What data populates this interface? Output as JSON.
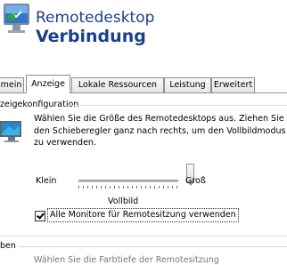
{
  "header": {
    "title_line1": "Remotedesktop",
    "title_line2": "Verbindung"
  },
  "tabs": [
    {
      "label": "mein",
      "active": false
    },
    {
      "label": "Anzeige",
      "active": true
    },
    {
      "label": "Lokale Ressourcen",
      "active": false
    },
    {
      "label": "Leistung",
      "active": false
    },
    {
      "label": "Erweitert",
      "active": false
    }
  ],
  "display_config": {
    "group_label": "zeigekonfiguration",
    "description": "Wählen Sie die Größe des Remotedesktops aus. Ziehen Sie den Schieberegler ganz nach rechts, um den Vollbildmodus zu verwenden.",
    "slider": {
      "min_label": "Klein",
      "max_label": "Groß",
      "value_label": "Vollbild",
      "position_fraction": 1.0
    },
    "checkbox": {
      "label": "Alle Monitore für Remotesitzung verwenden",
      "checked": true
    }
  },
  "next_group": {
    "label": "ben",
    "partial_text": "Wählen Sie die Farbtiefe der Remotesitzung"
  },
  "colors": {
    "title": "#1b3f8a"
  },
  "icons": {
    "app": "remote-desktop-icon",
    "monitor": "monitor-icon"
  }
}
